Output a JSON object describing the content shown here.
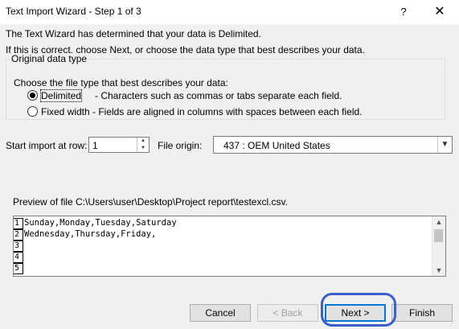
{
  "window": {
    "title": "Text Import Wizard - Step 1 of 3",
    "help_glyph": "?",
    "close_glyph": "✕"
  },
  "intro": {
    "line1": "The Text Wizard has determined that your data is Delimited.",
    "line2": "If this is correct, choose Next, or choose the data type that best describes your data."
  },
  "original_data_type": {
    "legend": "Original data type",
    "prompt": "Choose the file type that best describes your data:",
    "options": [
      {
        "label": "Delimited",
        "description": "- Characters such as commas or tabs separate each field.",
        "selected": true
      },
      {
        "label": "Fixed width",
        "description": "- Fields are aligned in columns with spaces between each field.",
        "selected": false
      }
    ]
  },
  "start_import": {
    "label": "Start import at row:",
    "value": "1"
  },
  "file_origin": {
    "label": "File origin:",
    "value": "437 : OEM United States"
  },
  "preview": {
    "label": "Preview of file C:\\Users\\user\\Desktop\\Project report\\testexcl.csv.",
    "row_numbers": [
      "1",
      "2",
      "3",
      "4",
      "5"
    ],
    "lines": [
      "Sunday,Monday,Tuesday,Saturday",
      "Wednesday,Thursday,Friday,",
      "",
      "",
      ""
    ]
  },
  "buttons": {
    "cancel": "Cancel",
    "back": "< Back",
    "next": "Next >",
    "finish": "Finish"
  }
}
